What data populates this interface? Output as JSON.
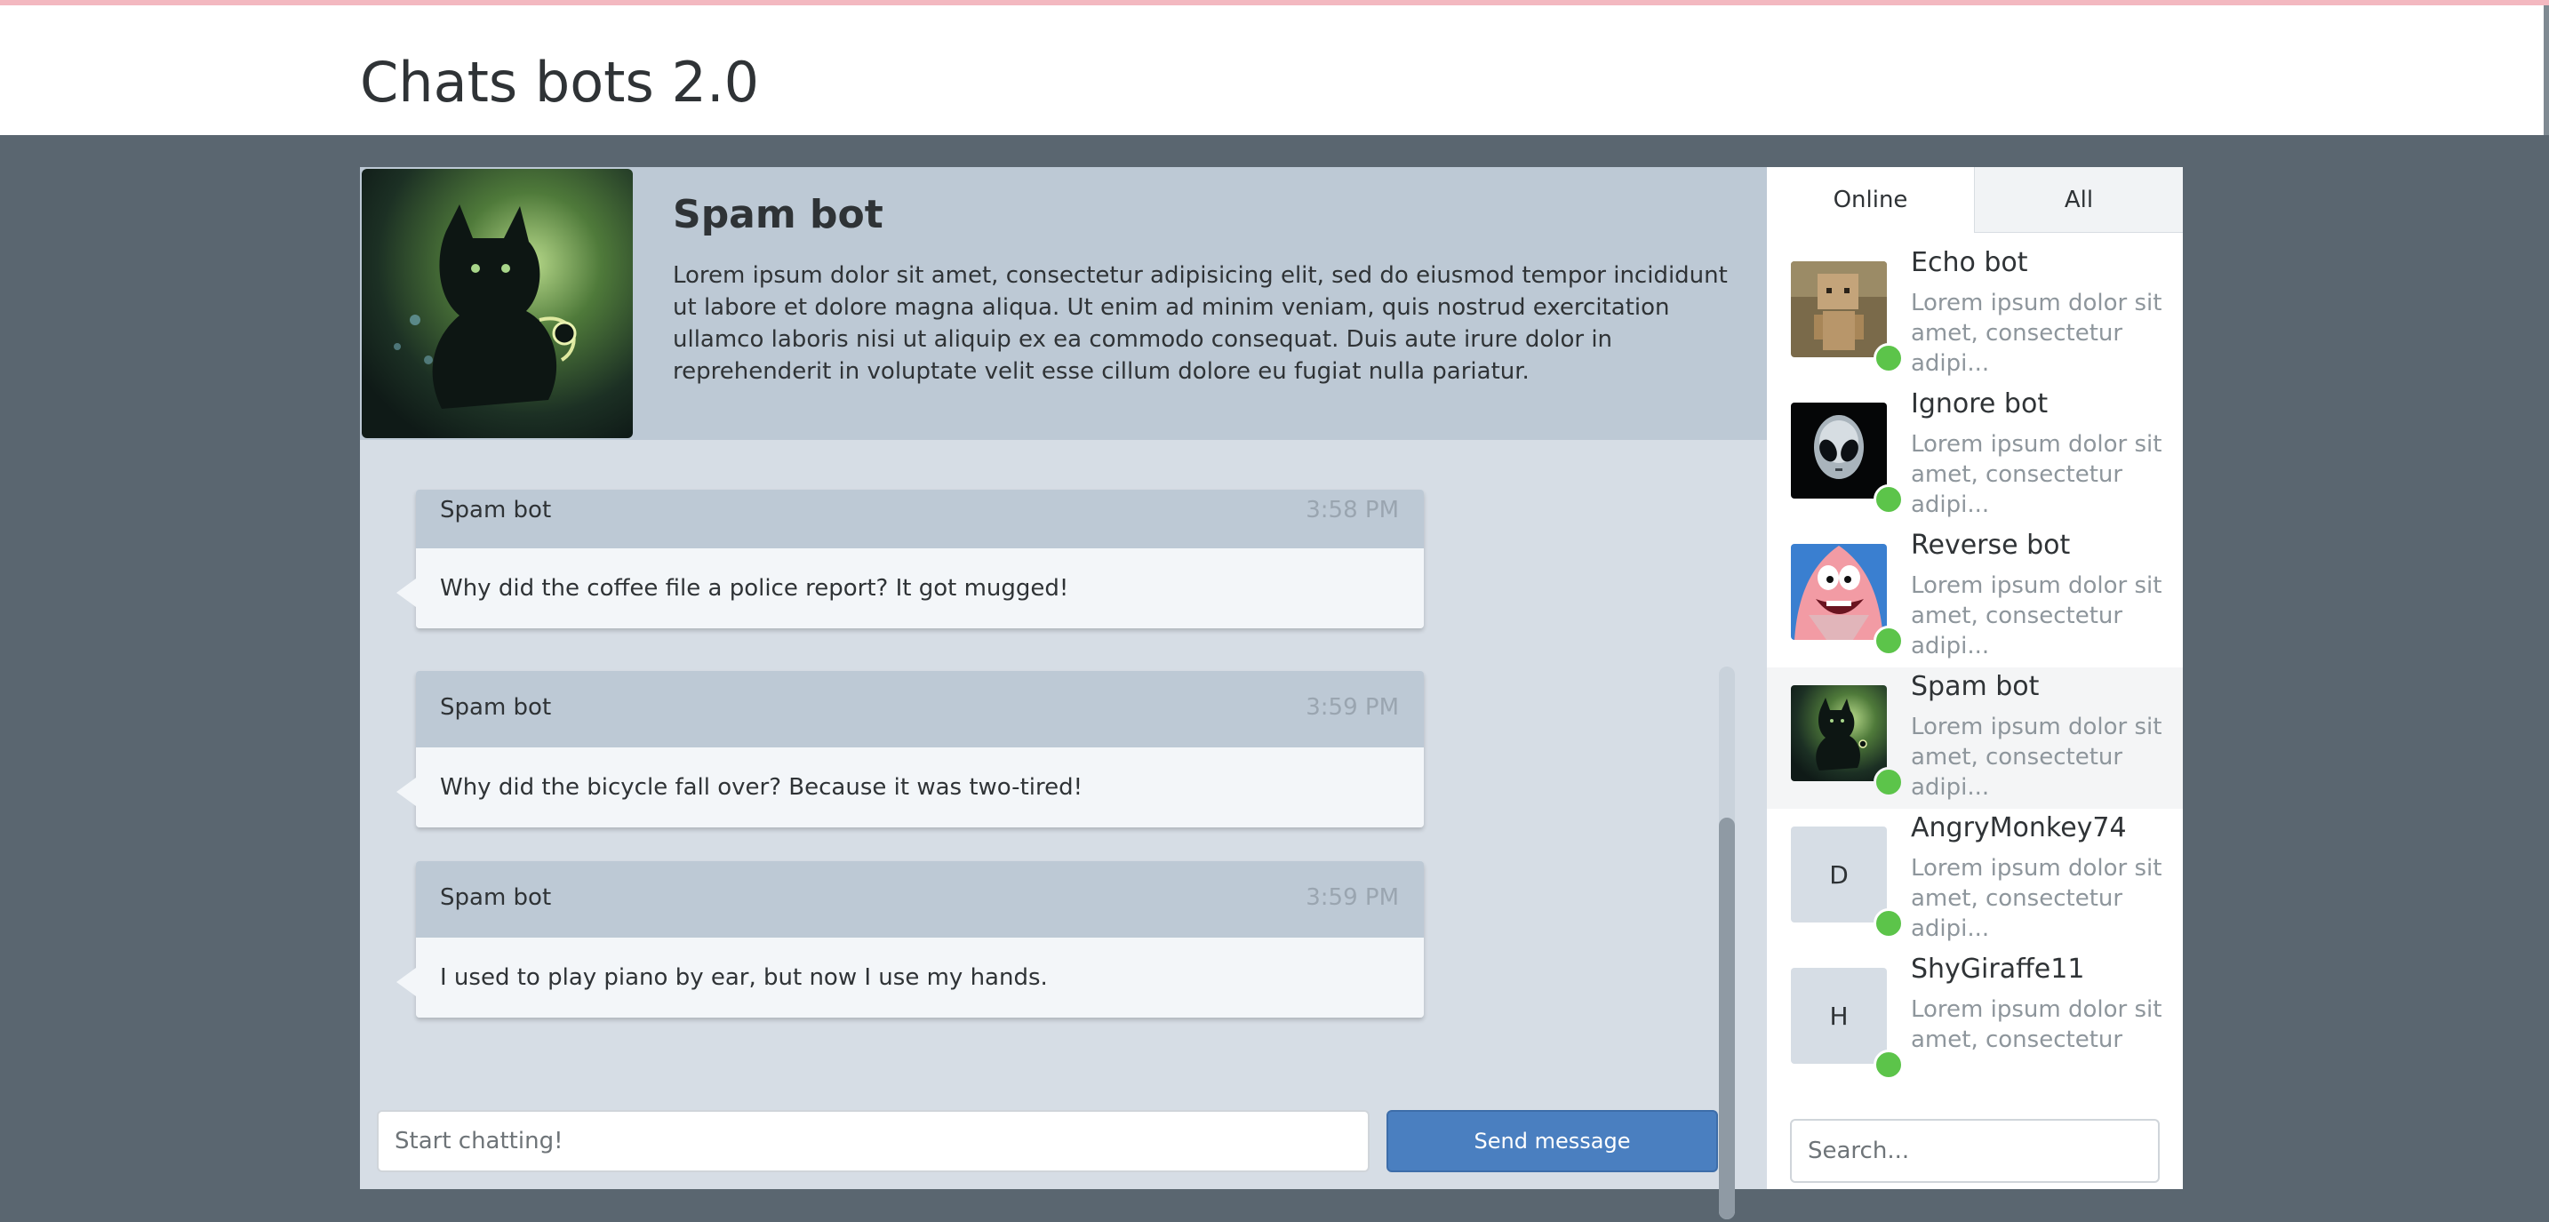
{
  "app": {
    "title": "Chats bots 2.0"
  },
  "active_bot": {
    "name": "Spam bot",
    "description": "Lorem ipsum dolor sit amet, consectetur adipisicing elit, sed do eiusmod tempor incididunt ut labore et dolore magna aliqua. Ut enim ad minim veniam, quis nostrud exercitation ullamco laboris nisi ut aliquip ex ea commodo consequat. Duis aute irure dolor in reprehenderit in voluptate velit esse cillum dolore eu fugiat nulla pariatur."
  },
  "messages": [
    {
      "author": "Spam bot",
      "time": "3:58 PM",
      "text": "Why did the coffee file a police report? It got mugged!"
    },
    {
      "author": "Spam bot",
      "time": "3:59 PM",
      "text": "Why did the bicycle fall over? Because it was two-tired!"
    },
    {
      "author": "Spam bot",
      "time": "3:59 PM",
      "text": "I used to play piano by ear, but now I use my hands."
    }
  ],
  "composer": {
    "placeholder": "Start chatting!",
    "send_label": "Send message"
  },
  "sidebar": {
    "tabs": [
      {
        "label": "Online"
      },
      {
        "label": "All"
      }
    ],
    "contacts": [
      {
        "name": "Echo bot",
        "desc": "Lorem ipsum dolor sit amet, consectetur adipi...",
        "avatar": "box-robot"
      },
      {
        "name": "Ignore bot",
        "desc": "Lorem ipsum dolor sit amet, consectetur adipi...",
        "avatar": "alien"
      },
      {
        "name": "Reverse bot",
        "desc": "Lorem ipsum dolor sit amet, consectetur adipi...",
        "avatar": "starfish"
      },
      {
        "name": "Spam bot",
        "desc": "Lorem ipsum dolor sit amet, consectetur adipi...",
        "avatar": "cat"
      },
      {
        "name": "AngryMonkey74",
        "desc": "Lorem ipsum dolor sit amet, consectetur adipi...",
        "initial": "D"
      },
      {
        "name": "ShyGiraffe11",
        "desc": "Lorem ipsum dolor sit amet, consectetur",
        "initial": "H"
      }
    ],
    "search_placeholder": "Search..."
  },
  "colors": {
    "accent": "#4a7fc0",
    "online": "#5cc44a",
    "header_bg": "#bdc9d5",
    "chat_bg": "#d6dde5"
  }
}
